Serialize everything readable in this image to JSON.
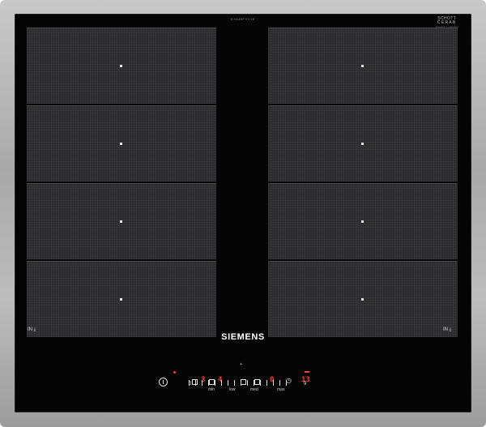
{
  "brand": "SIEMENS",
  "model_code": "EX645FXC1E",
  "schott": {
    "line1": "SCHOTT",
    "line2": "CERAN",
    "line3": "SCHOTT CERAN"
  },
  "zones": {
    "left": [
      "zone-left-1",
      "zone-left-2",
      "zone-left-3",
      "zone-left-4"
    ],
    "right": [
      "zone-right-1",
      "zone-right-2",
      "zone-right-3",
      "zone-right-4"
    ]
  },
  "in_label_left": "IN",
  "in_label_right": "IN",
  "controls": {
    "display_left": "3",
    "display_left2": "4",
    "display_mid": "0",
    "timer_display": "13",
    "slider_start": "0",
    "slider_end": "9",
    "slider_labels": [
      "min",
      "low",
      "med",
      "max"
    ]
  },
  "icons": [
    "power-icon",
    "cooking-sensor-icon",
    "powerboost-icon",
    "frying-sensor-icon",
    "pan-icon",
    "timer-icon",
    "flex-zone-icon",
    "heat-icon"
  ],
  "colors": {
    "glass": "#050505",
    "zone": "#2b2b2d",
    "display_red": "#ff3b2e",
    "frame": "#b0b0b0"
  }
}
